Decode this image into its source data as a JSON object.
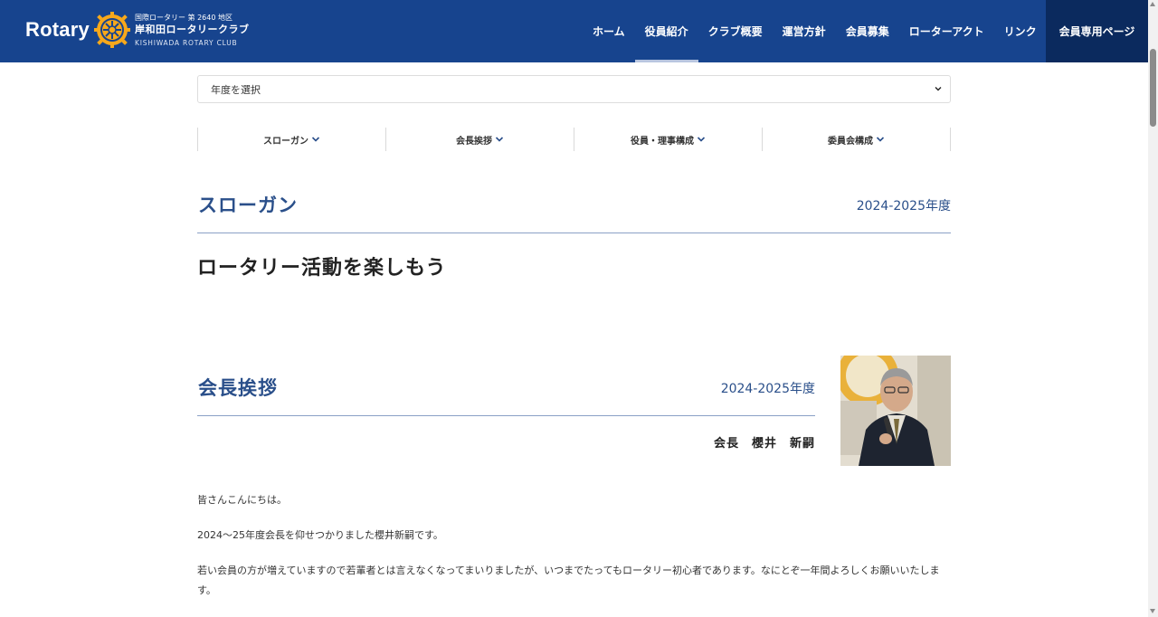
{
  "header": {
    "logo_word": "Rotary",
    "logo_line1": "国際ロータリー 第 2640 地区",
    "logo_line2": "岸和田ロータリークラブ",
    "logo_line3": "KISHIWADA ROTARY CLUB",
    "nav": [
      {
        "label": "ホーム"
      },
      {
        "label": "役員紹介"
      },
      {
        "label": "クラブ概要"
      },
      {
        "label": "運営方針"
      },
      {
        "label": "会員募集"
      },
      {
        "label": "ローターアクト"
      },
      {
        "label": "リンク"
      }
    ],
    "member_button": "会員専用ページ"
  },
  "year_select": {
    "value": "年度を選択"
  },
  "tabs": [
    {
      "label": "スローガン"
    },
    {
      "label": "会長挨拶"
    },
    {
      "label": "役員・理事構成"
    },
    {
      "label": "委員会構成"
    }
  ],
  "slogan_section": {
    "title": "スローガン",
    "year": "2024-2025年度",
    "text": "ロータリー活動を楽しもう"
  },
  "greeting_section": {
    "title": "会長挨拶",
    "year": "2024-2025年度",
    "name": "会長　櫻井　新嗣",
    "paragraphs": [
      "皆さんこんにちは。",
      "2024～25年度会長を仰せつかりました櫻井新嗣です。",
      "若い会員の方が増えていますので若輩者とは言えなくなってまいりましたが、いつまでたってもロータリー初心者であります。なにとぞ一年間よろしくお願いいたします。"
    ]
  },
  "colors": {
    "header_bg": "#17448e",
    "member_btn_bg": "#0b2a5e",
    "accent": "#2a4f8a"
  }
}
